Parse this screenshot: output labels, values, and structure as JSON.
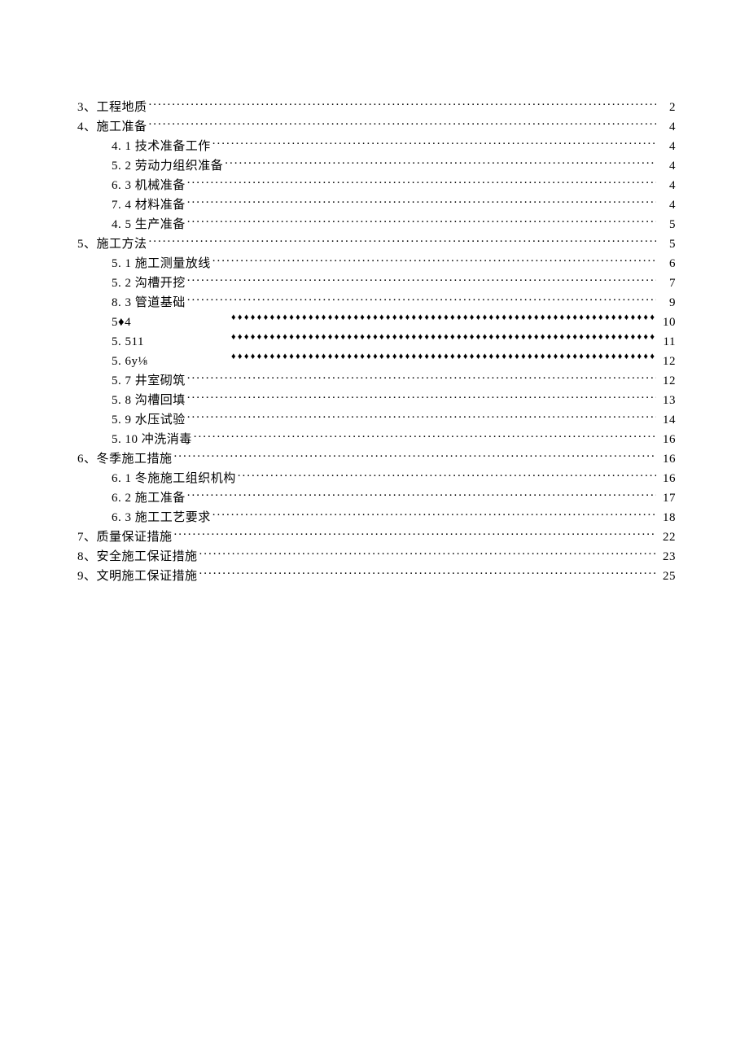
{
  "toc": [
    {
      "label": "3、工程地质",
      "page": "2",
      "indent": 0,
      "leader": "dots",
      "wide": false
    },
    {
      "label": "4、施工准备",
      "page": "4",
      "indent": 0,
      "leader": "dots",
      "wide": false
    },
    {
      "label": "4.  1 技术准备工作",
      "page": "4",
      "indent": 1,
      "leader": "dots",
      "wide": false
    },
    {
      "label": "5.  2 劳动力组织准备",
      "page": "4",
      "indent": 1,
      "leader": "dots",
      "wide": false
    },
    {
      "label": "6.  3 机械准备",
      "page": "4",
      "indent": 1,
      "leader": "dots",
      "wide": false
    },
    {
      "label": "7.  4 材料准备",
      "page": "4",
      "indent": 1,
      "leader": "dots",
      "wide": false
    },
    {
      "label": "4.  5 生产准备",
      "page": "5",
      "indent": 1,
      "leader": "dots",
      "wide": false
    },
    {
      "label": "5、施工方法",
      "page": "5",
      "indent": 0,
      "leader": "dots",
      "wide": false
    },
    {
      "label": "5.  1 施工测量放线",
      "page": "6",
      "indent": 1,
      "leader": "dots",
      "wide": false
    },
    {
      "label": "5.  2 沟槽开挖",
      "page": "7",
      "indent": 1,
      "leader": "dots",
      "wide": false
    },
    {
      "label": "8.  3 管道基础",
      "page": "9",
      "indent": 1,
      "leader": "dots",
      "wide": false
    },
    {
      "label": "5♦4",
      "page": "10",
      "indent": 1,
      "leader": "diamonds",
      "wide": true
    },
    {
      "label": "5. 511",
      "page": "11",
      "indent": 1,
      "leader": "diamonds",
      "wide": true
    },
    {
      "label": "5. 6y⅛",
      "page": "12",
      "indent": 1,
      "leader": "diamonds",
      "wide": true
    },
    {
      "label": "5. 7 井室砌筑",
      "page": "12",
      "indent": 1,
      "leader": "dots",
      "wide": false
    },
    {
      "label": "5. 8 沟槽回填",
      "page": "13",
      "indent": 1,
      "leader": "dots",
      "wide": false
    },
    {
      "label": "5. 9 水压试验",
      "page": "14",
      "indent": 1,
      "leader": "dots",
      "wide": false
    },
    {
      "label": "5. 10 冲洗消毒",
      "page": "16",
      "indent": 1,
      "leader": "dots",
      "wide": false
    },
    {
      "label": "6、冬季施工措施",
      "page": "16",
      "indent": 0,
      "leader": "dots",
      "wide": false
    },
    {
      "label": "6. 1 冬施施工组织机构",
      "page": "16",
      "indent": 1,
      "leader": "dots",
      "wide": false
    },
    {
      "label": "6. 2 施工准备",
      "page": "17",
      "indent": 1,
      "leader": "dots",
      "wide": false
    },
    {
      "label": "6. 3 施工工艺要求",
      "page": "18",
      "indent": 1,
      "leader": "dots",
      "wide": false
    },
    {
      "label": "7、质量保证措施",
      "page": "22",
      "indent": 0,
      "leader": "dots",
      "wide": false
    },
    {
      "label": "8、安全施工保证措施",
      "page": "23",
      "indent": 0,
      "leader": "dots",
      "wide": false
    },
    {
      "label": "9、文明施工保证措施",
      "page": "25",
      "indent": 0,
      "leader": "dots",
      "wide": false
    }
  ]
}
